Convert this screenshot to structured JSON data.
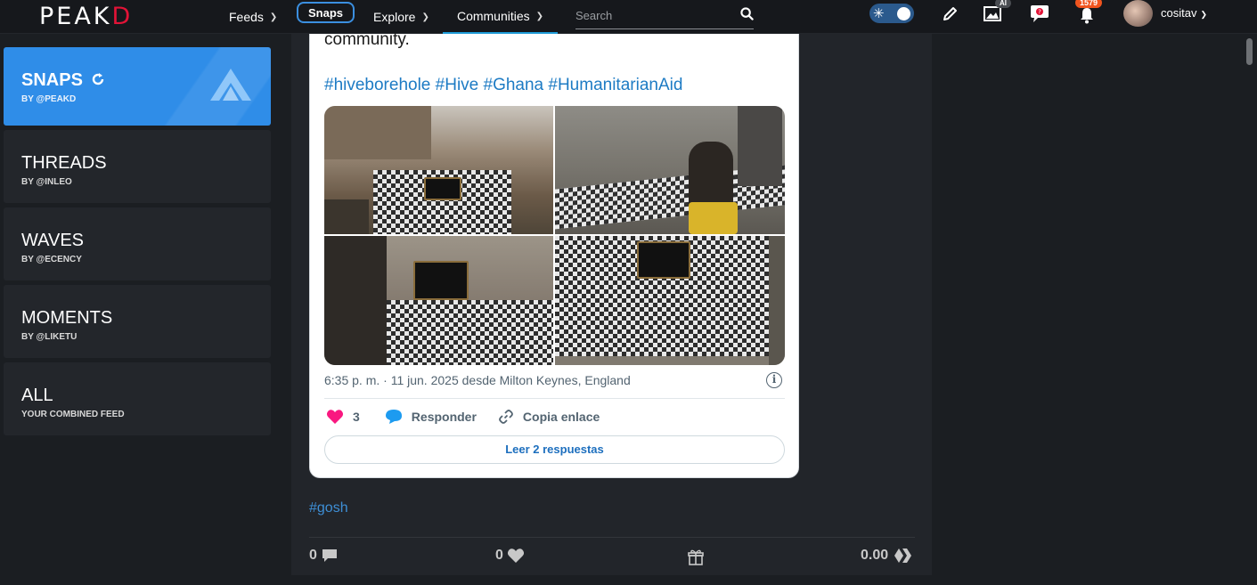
{
  "brand": {
    "logo_main": "PEAK",
    "logo_accent": "D"
  },
  "nav": {
    "feeds": "Feeds",
    "snaps": "Snaps",
    "explore": "Explore",
    "communities": "Communities",
    "search_placeholder": "Search"
  },
  "header": {
    "ai_label": "AI",
    "notifications_count": "1579",
    "username": "cositav"
  },
  "sidebar": {
    "items": [
      {
        "title": "SNAPS",
        "subtitle": "BY @PEAKD"
      },
      {
        "title": "THREADS",
        "subtitle": "BY @INLEO"
      },
      {
        "title": "WAVES",
        "subtitle": "BY @ECENCY"
      },
      {
        "title": "MOMENTS",
        "subtitle": "BY @LIKETU"
      },
      {
        "title": "ALL",
        "subtitle": "YOUR COMBINED FEED"
      }
    ]
  },
  "tweet": {
    "text_tail": "community.",
    "hashtags": "#hiveborehole #Hive #Ghana #HumanitarianAid",
    "timestamp": "6:35 p. m. · 11 jun. 2025 desde Milton Keynes, England",
    "likes": "3",
    "reply_label": "Responder",
    "copy_label": "Copia enlace",
    "read_replies": "Leer 2 respuestas"
  },
  "post": {
    "tag": "#gosh",
    "comments_count": "0",
    "votes_count": "0",
    "payout": "0.00"
  },
  "colors": {
    "accent": "#2f8de8",
    "brand_red": "#e31337",
    "badge": "#f0541e"
  }
}
